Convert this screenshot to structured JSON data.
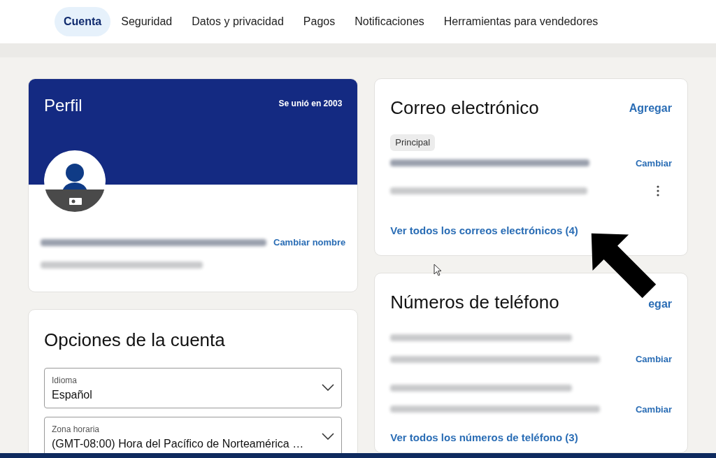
{
  "tabs": [
    {
      "label": "Cuenta",
      "selected": true
    },
    {
      "label": "Seguridad",
      "selected": false
    },
    {
      "label": "Datos y privacidad",
      "selected": false
    },
    {
      "label": "Pagos",
      "selected": false
    },
    {
      "label": "Notificaciones",
      "selected": false
    },
    {
      "label": "Herramientas para vendedores",
      "selected": false
    }
  ],
  "profile": {
    "title": "Perfil",
    "joined": "Se unió en 2003",
    "change_name": "Cambiar nombre"
  },
  "account_options": {
    "title": "Opciones de la cuenta",
    "fields": [
      {
        "label": "Idioma",
        "value": "Español"
      },
      {
        "label": "Zona horaria",
        "value": "(GMT-08:00) Hora del Pacífico de Norteamérica …"
      }
    ]
  },
  "email": {
    "title": "Correo electrónico",
    "action": "Agregar",
    "badge": "Principal",
    "change": "Cambiar",
    "view_all": "Ver todos los correos electrónicos (4)"
  },
  "phones": {
    "title": "Números de teléfono",
    "action": "egar",
    "rows": [
      {
        "change": "Cambiar"
      },
      {
        "change": "Cambiar"
      }
    ],
    "view_all": "Ver todos los números de teléfono (3)"
  }
}
